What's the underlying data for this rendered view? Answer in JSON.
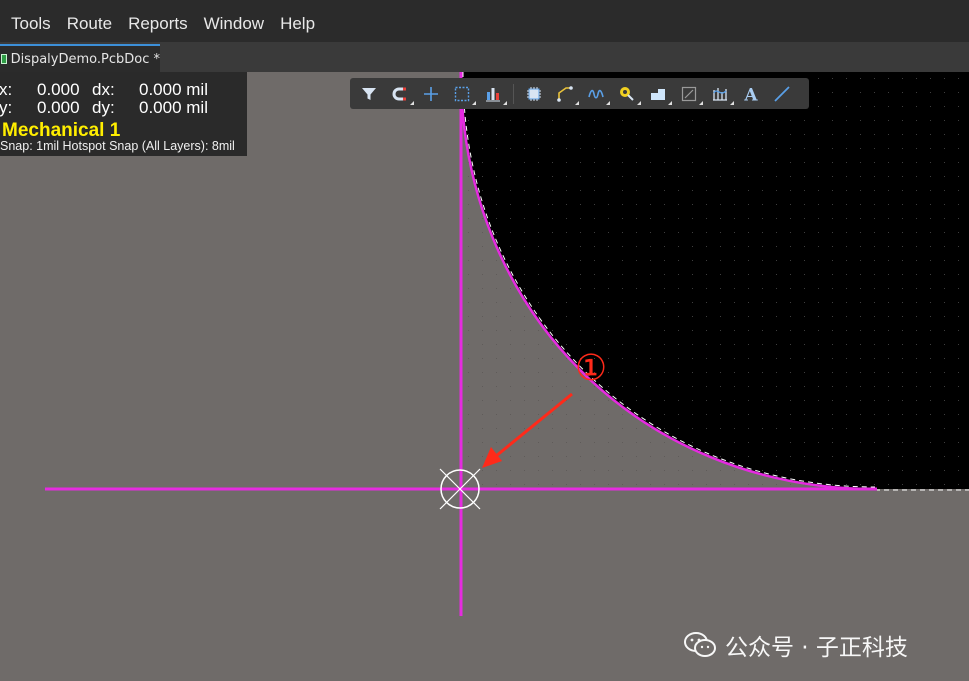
{
  "menu": {
    "items": [
      "Tools",
      "Route",
      "Reports",
      "Window",
      "Help"
    ]
  },
  "tab": {
    "label": "DispalyDemo.PcbDoc *"
  },
  "hud": {
    "x_label": "x:",
    "x_value": "0.000",
    "dx_label": "dx:",
    "dx_value": "0.000 mil",
    "y_label": "y:",
    "y_value": "0.000",
    "dy_label": "dy:",
    "dy_value": "0.000 mil",
    "layer": "Mechanical 1",
    "snap": "Snap: 1mil Hotspot Snap (All Layers): 8mil"
  },
  "toolbar": {
    "buttons": [
      {
        "name": "filter-icon",
        "dropdown": false
      },
      {
        "name": "snap-magnet-icon",
        "dropdown": true
      },
      {
        "name": "add-cross-icon",
        "dropdown": false
      },
      {
        "name": "select-rect-icon",
        "dropdown": true
      },
      {
        "name": "align-chart-icon",
        "dropdown": true
      },
      {
        "name": "component-icon",
        "dropdown": false
      },
      {
        "name": "route-track-icon",
        "dropdown": true
      },
      {
        "name": "interactive-route-icon",
        "dropdown": true
      },
      {
        "name": "via-pin-icon",
        "dropdown": true
      },
      {
        "name": "polygon-fill-icon",
        "dropdown": true
      },
      {
        "name": "region-icon",
        "dropdown": true
      },
      {
        "name": "length-tune-icon",
        "dropdown": true
      },
      {
        "name": "text-icon",
        "dropdown": false
      },
      {
        "name": "line-icon",
        "dropdown": false
      }
    ]
  },
  "annotation": {
    "marker": "①"
  },
  "watermark": {
    "text": "公众号 · 子正科技"
  },
  "colors": {
    "board": "#000000",
    "background": "#6f6b69",
    "crosshair": "#e52be0",
    "annotation": "#ff2a1a",
    "layer_text": "#ffee00"
  }
}
